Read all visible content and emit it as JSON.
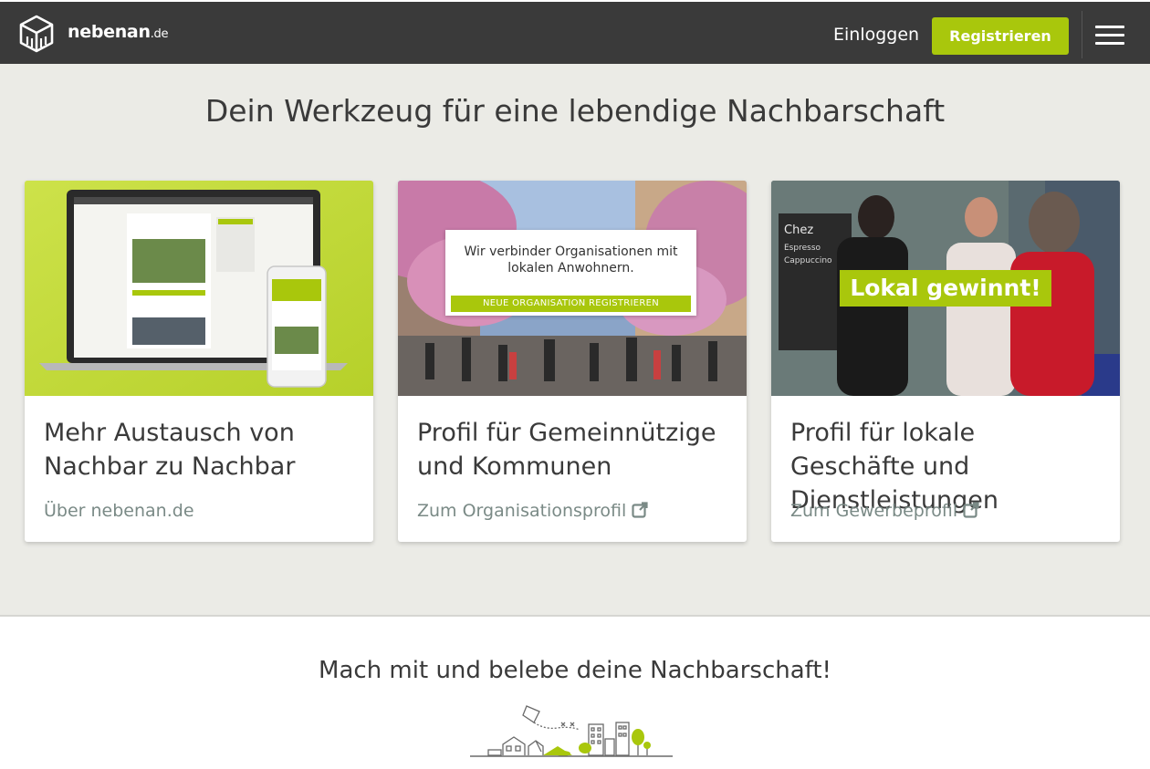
{
  "header": {
    "brand_name": "nebenan",
    "brand_tld": ".de",
    "login_label": "Einloggen",
    "register_label": "Registrieren",
    "menu_icon": "hamburger-menu-icon"
  },
  "hero": {
    "title": "Dein Werkzeug für eine lebendige Nachbarschaft"
  },
  "cards": [
    {
      "title": "Mehr Austausch von Nachbar zu Nachbar",
      "link": "Über nebenan.de",
      "image": "laptop-phone-mockup"
    },
    {
      "title": "Profil für Gemeinnützige und Kommunen",
      "link": "Zum Organisationsprofil",
      "overlay_text": "Wir verbinder Organisationen mit lokalen Anwohnern.",
      "overlay_button": "NEUE ORGANISATION REGISTRIEREN",
      "image": "street-festival-photo",
      "link_icon": "external-link-icon"
    },
    {
      "title": "Profil für lokale Geschäfte und Dienstleistungen",
      "link": "Zum Gewerbeprofil",
      "badge": "Lokal gewinnt!",
      "image": "shop-owners-photo",
      "link_icon": "external-link-icon"
    }
  ],
  "bottom": {
    "title": "Mach mit und belebe deine Nachbarschaft!",
    "illustration": "neighborhood-city-illustration"
  },
  "colors": {
    "header_bg": "#3a3a3a",
    "accent": "#a9c70c",
    "hero_bg": "#ebebe6",
    "link": "#7a8a86"
  }
}
